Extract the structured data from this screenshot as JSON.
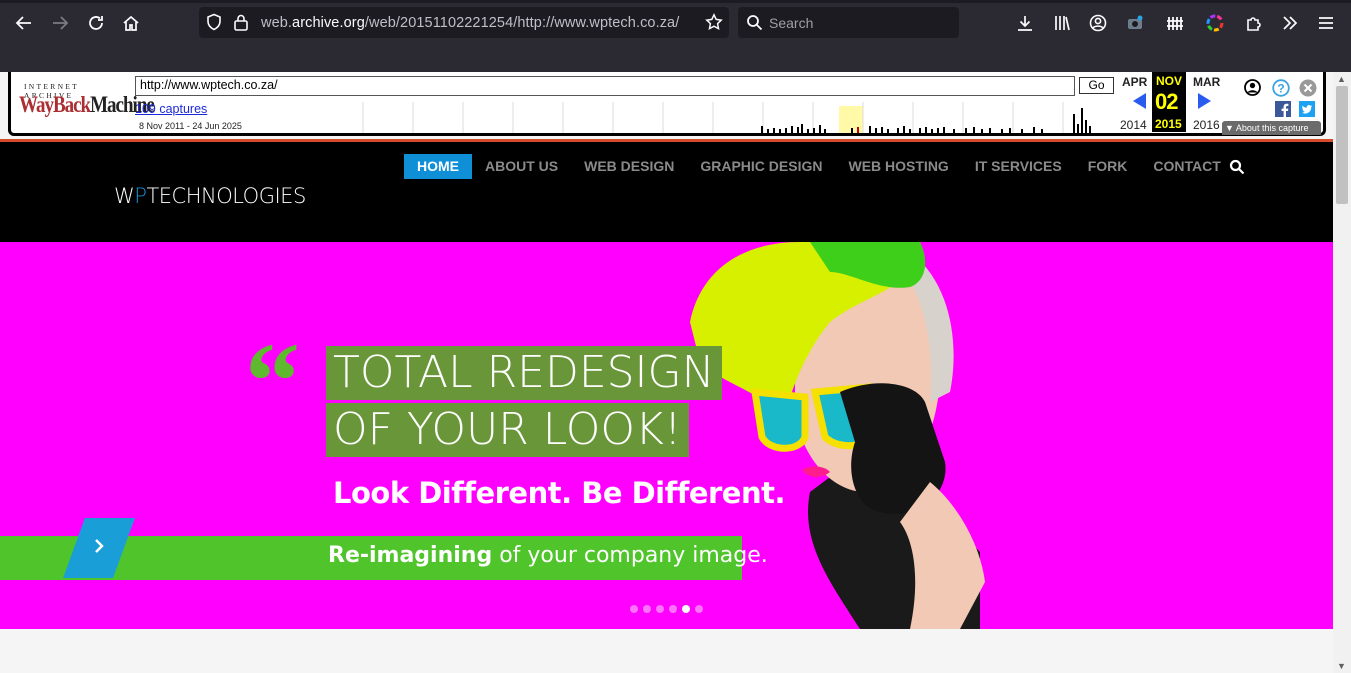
{
  "browser": {
    "url_prefix": "web.",
    "url_domain": "archive.org",
    "url_path": "/web/20151102221254/http://www.wptech.co.za/",
    "search_placeholder": "Search"
  },
  "wayback": {
    "logo_top": "INTERNET ARCHIVE",
    "logo_main_red": "WayBack",
    "logo_main_dark": "Machine",
    "url_value": "http://www.wptech.co.za/",
    "go_label": "Go",
    "captures": "109 captures",
    "range": "8 Nov 2011 - 24 Jun 2025",
    "prev_month": "APR",
    "cur_month": "NOV",
    "cur_day": "02",
    "next_month": "MAR",
    "prev_year": "2014",
    "cur_year": "2015",
    "next_year": "2016",
    "about": "About this capture"
  },
  "site": {
    "logo_w": "W",
    "logo_p": "P",
    "logo_rest": "TECHNOLOGIES",
    "menu": [
      {
        "label": "HOME",
        "active": true
      },
      {
        "label": "ABOUT US"
      },
      {
        "label": "WEB DESIGN"
      },
      {
        "label": "GRAPHIC DESIGN"
      },
      {
        "label": "WEB HOSTING"
      },
      {
        "label": "IT SERVICES"
      },
      {
        "label": "FORK"
      },
      {
        "label": "CONTACT"
      }
    ]
  },
  "hero": {
    "quote_mark": "“",
    "headline_1": "TOTAL REDESIGN",
    "headline_2": "OF YOUR LOOK!",
    "subheadline": "Look Different. Be Different.",
    "strip_bold": "Re-imagining",
    "strip_rest": " of your company image.",
    "slide_count": 6,
    "active_slide": 5
  },
  "colors": {
    "hero_bg": "#ff00ff",
    "accent_green": "#6a963a",
    "strip_green": "#4fc52b",
    "menu_active": "#0f8fd6"
  }
}
